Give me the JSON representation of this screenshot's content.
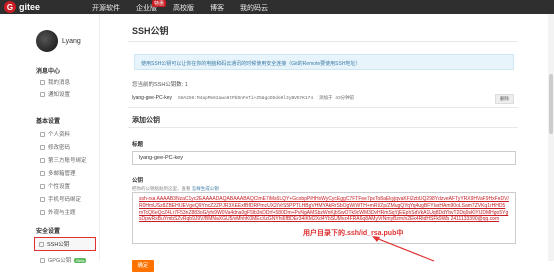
{
  "brand": {
    "logo_letter": "G",
    "name": "gitee"
  },
  "nav": [
    {
      "label": "开源软件"
    },
    {
      "label": "企业版",
      "badge": "特惠"
    },
    {
      "label": "高校版"
    },
    {
      "label": "博客"
    },
    {
      "label": "我的码云"
    }
  ],
  "profile": {
    "name": "Lyang"
  },
  "sidebar": {
    "sections": [
      {
        "title": "消息中心",
        "items": [
          "我的消息",
          "通知设置"
        ]
      },
      {
        "title": "基本设置",
        "items": [
          "个人资料",
          "修改密码",
          "第三方账号绑定",
          "多邮箱管理",
          "个性设置",
          "手机号码绑定",
          "外观与主题"
        ]
      },
      {
        "title": "安全设置",
        "items": [
          "SSH公钥",
          "GPG公钥"
        ]
      }
    ],
    "active": "SSH公钥",
    "beta": "Beta"
  },
  "main": {
    "title": "SSH公钥",
    "info": "使用SSH公钥可以让你在你的电脑和码云通讯的时候使用安全连接（Git的Remote要使用SSH地址）",
    "count": "您当前的SSH公钥数: 1",
    "key_name": "lyang-gee-PC-key",
    "fingerprint": "SHA256:M4apPm62awoHtPbDnFeTi+Z5&goDSdeHl3yBVEYK174",
    "key_time": "添加于 43分钟前",
    "delete_label": "删除",
    "add_title": "添加公钥",
    "title_label": "标题",
    "title_value": "lyang-gee-PC-key",
    "key_label": "公钥",
    "key_hint": "把你的公钥粘贴到这里，查看",
    "key_hint_link": "怎样生成公钥",
    "key_value": "ssh-rsa AAAAB3NzaC1yc2EAAAADAQABAAABAQClmE7iMs6LQY+GcobpPiHHsWyCycEggC7FTFee7psTo8aEkyjqvaKFi2zbUQ298YdzveAFTyYRX9HVaF9HxFeDV/R0HmUSz8ZBEHIJEVgeQ9YncZ2ZPJR3XEExfBfDRPmcUX2/VrS5PPTLHBgVHMYAkRrSbOgW/WTH+mRI/Zp/ZMugQYqYq4ugBFYIarHAm90oLSam7ZVKq1rHHD5mTcQ6eQcZ4Lr7F53nZ883oG/yfv9W0Va4dna0gF5lb3nDDrf+580Dm+PvNgAMSbzWnKjbSwOTk9cWM3DvHRmSqYjEEphSdVkA1Uq8DdYbvT2Dq9sKlYUDMHgo5YgsDpwRsBuYmbSZvRqb9J9V/BMNaXGU5/vMhhK0MEcXzGNYhi6fBDEr34iKM2Xd4YbSUMvz4FRA6q8AMyVrNmyBzm/n2Ek4RtdHSFk9Wb 2411133390@qq.com",
    "confirm_label": "确定",
    "annotation": "用户目录下的.ssh/id_rsa.pub中"
  },
  "colors": {
    "topbar": "#2f2f2f",
    "brand_red": "#c71d23",
    "confirm": "#fe7300",
    "annotation": "#e03030"
  }
}
